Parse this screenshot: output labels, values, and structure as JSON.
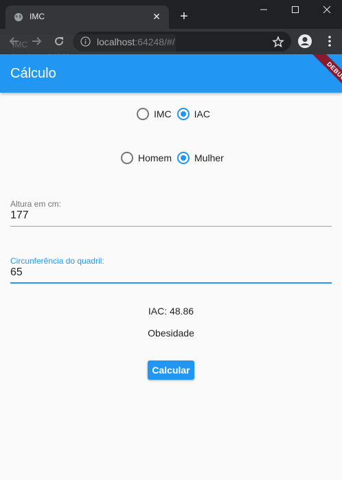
{
  "browser": {
    "tab_title": "IMC",
    "url_host": "localhost",
    "url_rest": ":64248/#/",
    "tooltip_title": "IMC",
    "tooltip_url": "localhost:64248"
  },
  "app": {
    "title": "Cálculo",
    "debug_banner": "DEBUG",
    "accent_color": "#2196f3"
  },
  "calc_type": {
    "options": [
      {
        "label": "IMC",
        "selected": false
      },
      {
        "label": "IAC",
        "selected": true
      }
    ]
  },
  "gender": {
    "options": [
      {
        "label": "Homem",
        "selected": false
      },
      {
        "label": "Mulher",
        "selected": true
      }
    ]
  },
  "fields": {
    "height": {
      "label": "Altura em cm:",
      "value": "177"
    },
    "hip": {
      "label": "Circunferência do quadril:",
      "value": "65"
    }
  },
  "result": {
    "value_text": "IAC: 48.86",
    "classification": "Obesidade"
  },
  "actions": {
    "calculate_label": "Calcular"
  }
}
